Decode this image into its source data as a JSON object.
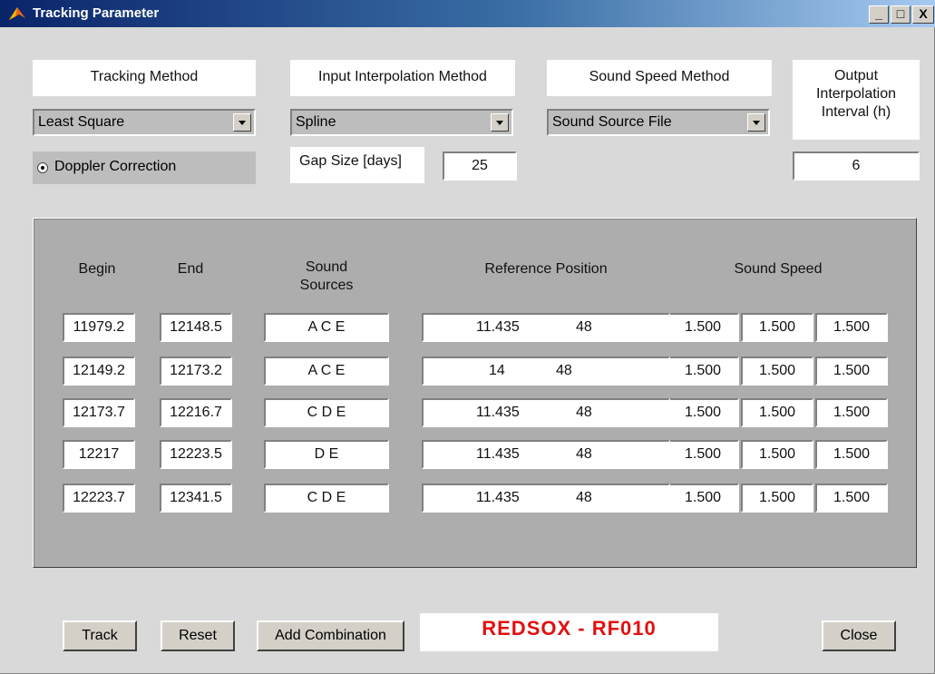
{
  "window": {
    "title": "Tracking Parameter",
    "minimize_label": "_",
    "maximize_label": "□",
    "close_label": "X"
  },
  "settings": {
    "tracking_method_label": "Tracking Method",
    "tracking_method_value": "Least Square",
    "input_interp_label": "Input Interpolation Method",
    "input_interp_value": "Spline",
    "sound_speed_method_label": "Sound Speed Method",
    "sound_speed_method_value": "Sound Source File",
    "output_interval_label_line1": "Output",
    "output_interval_label_line2": "Interpolation",
    "output_interval_label_line3": "Interval (h)",
    "output_interval_value": "6",
    "doppler_label": "Doppler Correction",
    "gap_size_label": "Gap Size [days]",
    "gap_size_value": "25"
  },
  "table": {
    "headers": {
      "begin": "Begin",
      "end": "End",
      "sources_line1": "Sound",
      "sources_line2": "Sources",
      "ref_pos": "Reference Position",
      "speed": "Sound Speed"
    },
    "rows": [
      {
        "begin": "11979.2",
        "end": "12148.5",
        "sources": "A C E",
        "ref_a": "11.435",
        "ref_b": "48",
        "s1": "1.500",
        "s2": "1.500",
        "s3": "1.500"
      },
      {
        "begin": "12149.2",
        "end": "12173.2",
        "sources": "A C E",
        "ref_a": "14",
        "ref_b": "48",
        "s1": "1.500",
        "s2": "1.500",
        "s3": "1.500"
      },
      {
        "begin": "12173.7",
        "end": "12216.7",
        "sources": "C D  E",
        "ref_a": "11.435",
        "ref_b": "48",
        "s1": "1.500",
        "s2": "1.500",
        "s3": "1.500"
      },
      {
        "begin": "12217",
        "end": "12223.5",
        "sources": "D E",
        "ref_a": "11.435",
        "ref_b": "48",
        "s1": "1.500",
        "s2": "1.500",
        "s3": "1.500"
      },
      {
        "begin": "12223.7",
        "end": "12341.5",
        "sources": "C D E",
        "ref_a": "11.435",
        "ref_b": "48",
        "s1": "1.500",
        "s2": "1.500",
        "s3": "1.500"
      }
    ]
  },
  "footer": {
    "track_label": "Track",
    "reset_label": "Reset",
    "add_label": "Add Combination",
    "banner": "REDSOX - RF010",
    "close_label": "Close"
  },
  "colors": {
    "banner_text": "#e01010",
    "panel_bg": "#adadad",
    "window_bg": "#d9d9d9"
  }
}
